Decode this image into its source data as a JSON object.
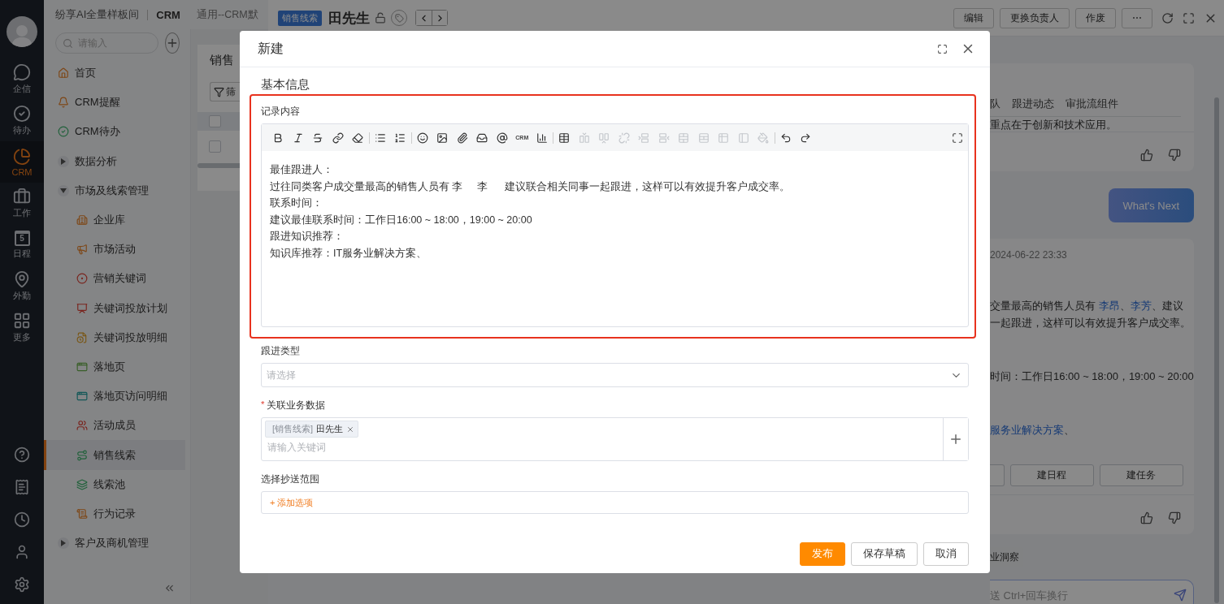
{
  "app": {
    "title": "纷享AI全量样板间",
    "module": "CRM",
    "breadcrumb": "通用--CRM默"
  },
  "rail": {
    "items": [
      {
        "label": "企信",
        "selected": false
      },
      {
        "label": "待办",
        "selected": false
      },
      {
        "label": "CRM",
        "selected": true
      },
      {
        "label": "工作",
        "selected": false
      },
      {
        "label": "日程",
        "selected": false,
        "day": "5"
      },
      {
        "label": "外勤",
        "selected": false
      },
      {
        "label": "更多",
        "selected": false
      }
    ]
  },
  "sidebar": {
    "search": {
      "placeholder": "请输入"
    },
    "items": [
      {
        "label": "首页",
        "selected": false
      },
      {
        "label": "CRM提醒",
        "selected": false
      },
      {
        "label": "CRM待办",
        "selected": false
      },
      {
        "label": "数据分析",
        "expanded": false
      },
      {
        "label": "市场及线索管理",
        "expanded": true,
        "children": [
          {
            "label": "企业库",
            "selected": false
          },
          {
            "label": "市场活动",
            "selected": false
          },
          {
            "label": "营销关键词",
            "selected": false
          },
          {
            "label": "关键词投放计划",
            "selected": false
          },
          {
            "label": "关键词投放明细",
            "selected": false
          },
          {
            "label": "落地页",
            "selected": false
          },
          {
            "label": "落地页访问明细",
            "selected": false
          },
          {
            "label": "活动成员",
            "selected": false
          },
          {
            "label": "销售线索",
            "selected": true
          },
          {
            "label": "线索池",
            "selected": false
          },
          {
            "label": "行为记录",
            "selected": false
          }
        ]
      },
      {
        "label": "客户及商机管理",
        "expanded": false
      }
    ]
  },
  "list_panel": {
    "title": "销售",
    "filter": "筛",
    "header_checked": false,
    "rows": [
      {
        "checked": false
      }
    ]
  },
  "detail": {
    "tag": "销售线索",
    "name": "田先生",
    "actions": [
      "编辑",
      "更换负责人",
      "作废",
      "⋯"
    ]
  },
  "assistant": {
    "tabs": [
      {
        "label": "队",
        "selected": false
      },
      {
        "label": "跟进动态",
        "selected": false
      },
      {
        "label": "审批流组件",
        "selected": false
      }
    ],
    "snippet": "重点在于创新和技术应用。",
    "prompt": "What's Next",
    "reply": {
      "time": "2024-06-22 23:33",
      "paragraphs": [
        [
          [
            {
              "text": "交量最高的销售人员有 ",
              "link": false
            },
            {
              "text": "李昂",
              "link": true
            },
            {
              "text": "、",
              "link": false
            },
            {
              "text": "李芳",
              "link": true
            },
            {
              "text": "、建议",
              "link": false
            }
          ],
          [
            {
              "text": "一起跟进，这样可以有效提升客户成交率。",
              "link": false
            }
          ]
        ],
        [
          [
            {
              "text": "时间：工作日16:00 ~ 18:00，19:00 ~ 20:00",
              "link": false
            }
          ]
        ],
        [
          [
            {
              "text": "服务业解决方案",
              "link": true
            },
            {
              "text": "、",
              "link": false
            }
          ]
        ]
      ]
    },
    "actions": [
      "建日程",
      "建任务"
    ],
    "chip": "业洞察",
    "input": {
      "placeholder": "送 Ctrl+回车换行"
    }
  },
  "modal": {
    "title": "新建",
    "section": "基本信息",
    "content": {
      "label": "记录内容",
      "toolbar": [
        {
          "kind": "icon",
          "disabled": false
        },
        {
          "kind": "icon",
          "disabled": false
        },
        {
          "kind": "icon",
          "disabled": false
        },
        {
          "kind": "icon",
          "disabled": false
        },
        {
          "kind": "icon",
          "disabled": false
        },
        {
          "kind": "separator"
        },
        {
          "kind": "icon",
          "disabled": false
        },
        {
          "kind": "icon",
          "disabled": false
        },
        {
          "kind": "separator"
        },
        {
          "kind": "icon",
          "disabled": false
        },
        {
          "kind": "icon",
          "disabled": false
        },
        {
          "kind": "icon",
          "disabled": false
        },
        {
          "kind": "icon",
          "disabled": false
        },
        {
          "kind": "icon",
          "disabled": false
        },
        {
          "kind": "text",
          "label": "CRM",
          "disabled": false
        },
        {
          "kind": "icon",
          "disabled": false
        },
        {
          "kind": "separator"
        },
        {
          "kind": "icon",
          "disabled": false
        },
        {
          "kind": "icon",
          "disabled": true
        },
        {
          "kind": "icon",
          "disabled": true
        },
        {
          "kind": "icon",
          "disabled": true
        },
        {
          "kind": "icon",
          "disabled": true
        },
        {
          "kind": "icon",
          "disabled": true
        },
        {
          "kind": "icon",
          "disabled": true
        },
        {
          "kind": "icon",
          "disabled": true
        },
        {
          "kind": "icon",
          "disabled": true
        },
        {
          "kind": "icon",
          "disabled": true
        },
        {
          "kind": "icon",
          "disabled": true
        },
        {
          "kind": "separator"
        },
        {
          "kind": "icon",
          "disabled": false
        },
        {
          "kind": "icon",
          "disabled": false
        }
      ],
      "lines": [
        "最佳跟进人：",
        "过往同类客户成交量最高的销售人员有 李     李      建议联合相关同事一起跟进，这样可以有效提升客户成交率。",
        "联系时间：",
        "建议最佳联系时间：工作日16:00 ~ 18:00，19:00 ~ 20:00",
        "跟进知识推荐：",
        "知识库推荐：IT服务业解决方案、"
      ]
    },
    "follow_type": {
      "label": "跟进类型",
      "placeholder": "请选择"
    },
    "related": {
      "label": "关联业务数据",
      "required_mark": "*",
      "tags": [
        {
          "prefix": "[销售线索]",
          "name": "田先生"
        }
      ],
      "placeholder": "请输入关键词"
    },
    "cc": {
      "label": "选择抄送范围",
      "add": "+ 添加选项"
    },
    "buttons": [
      {
        "label": "发布",
        "kind": "primary"
      },
      {
        "label": "保存草稿",
        "kind": "default"
      },
      {
        "label": "取消",
        "kind": "default"
      }
    ]
  }
}
